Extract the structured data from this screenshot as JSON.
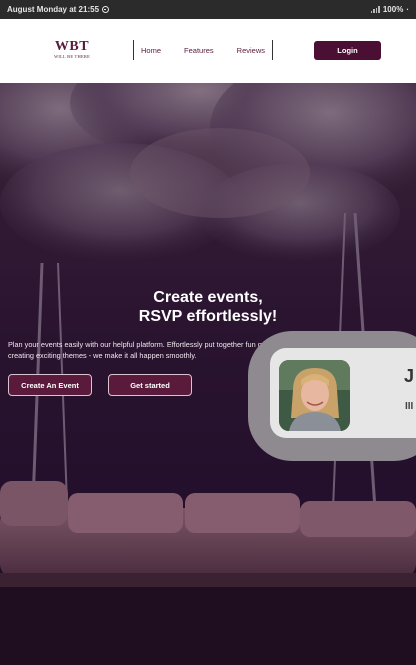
{
  "statusbar": {
    "time": "August Monday at 21:55",
    "battery": "100%"
  },
  "header": {
    "logo_mark": "WBT",
    "logo_sub": "WILL BE THERE",
    "nav": [
      "Home",
      "Features",
      "Reviews"
    ],
    "login_label": "Login"
  },
  "hero": {
    "headline_line1": "Create events,",
    "headline_line2": "RSVP effortlessly!",
    "paragraph": "Plan your events easily with our helpful platform. Effortlessly put together fun gatherings, from carefully making guest lists to creating exciting themes - we make it all happen smoothly.",
    "create_event_label": "Create An Event",
    "get_started_label": "Get started"
  },
  "testimonial": {
    "name_initial": "J",
    "name_sub": "III"
  },
  "colors": {
    "brand": "#4a0f32",
    "accent": "#5a1a3c",
    "background": "#2a1430"
  }
}
